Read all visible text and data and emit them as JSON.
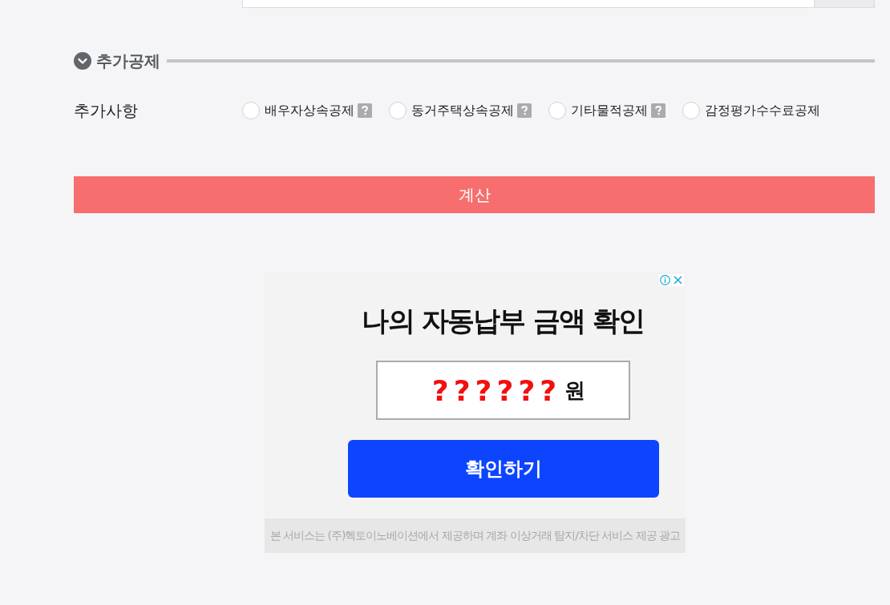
{
  "section": {
    "title": "추가공제",
    "expanded": true
  },
  "options_row": {
    "label": "추가사항",
    "options": [
      {
        "label": "배우자상속공제",
        "selected": false,
        "help": true
      },
      {
        "label": "동거주택상속공제",
        "selected": false,
        "help": true
      },
      {
        "label": "기타물적공제",
        "selected": false,
        "help": true
      },
      {
        "label": "감정평가수수료공제",
        "selected": false,
        "help": false
      }
    ]
  },
  "calculate_button": "계산",
  "ad": {
    "title": "나의 자동납부 금액 확인",
    "amount": "??????",
    "unit": "원",
    "button": "확인하기",
    "footer": "본 서비스는 (주)헥토이노베이션에서 제공하며 계좌 이상거래 탐지/차단 서비스 제공 광고"
  }
}
